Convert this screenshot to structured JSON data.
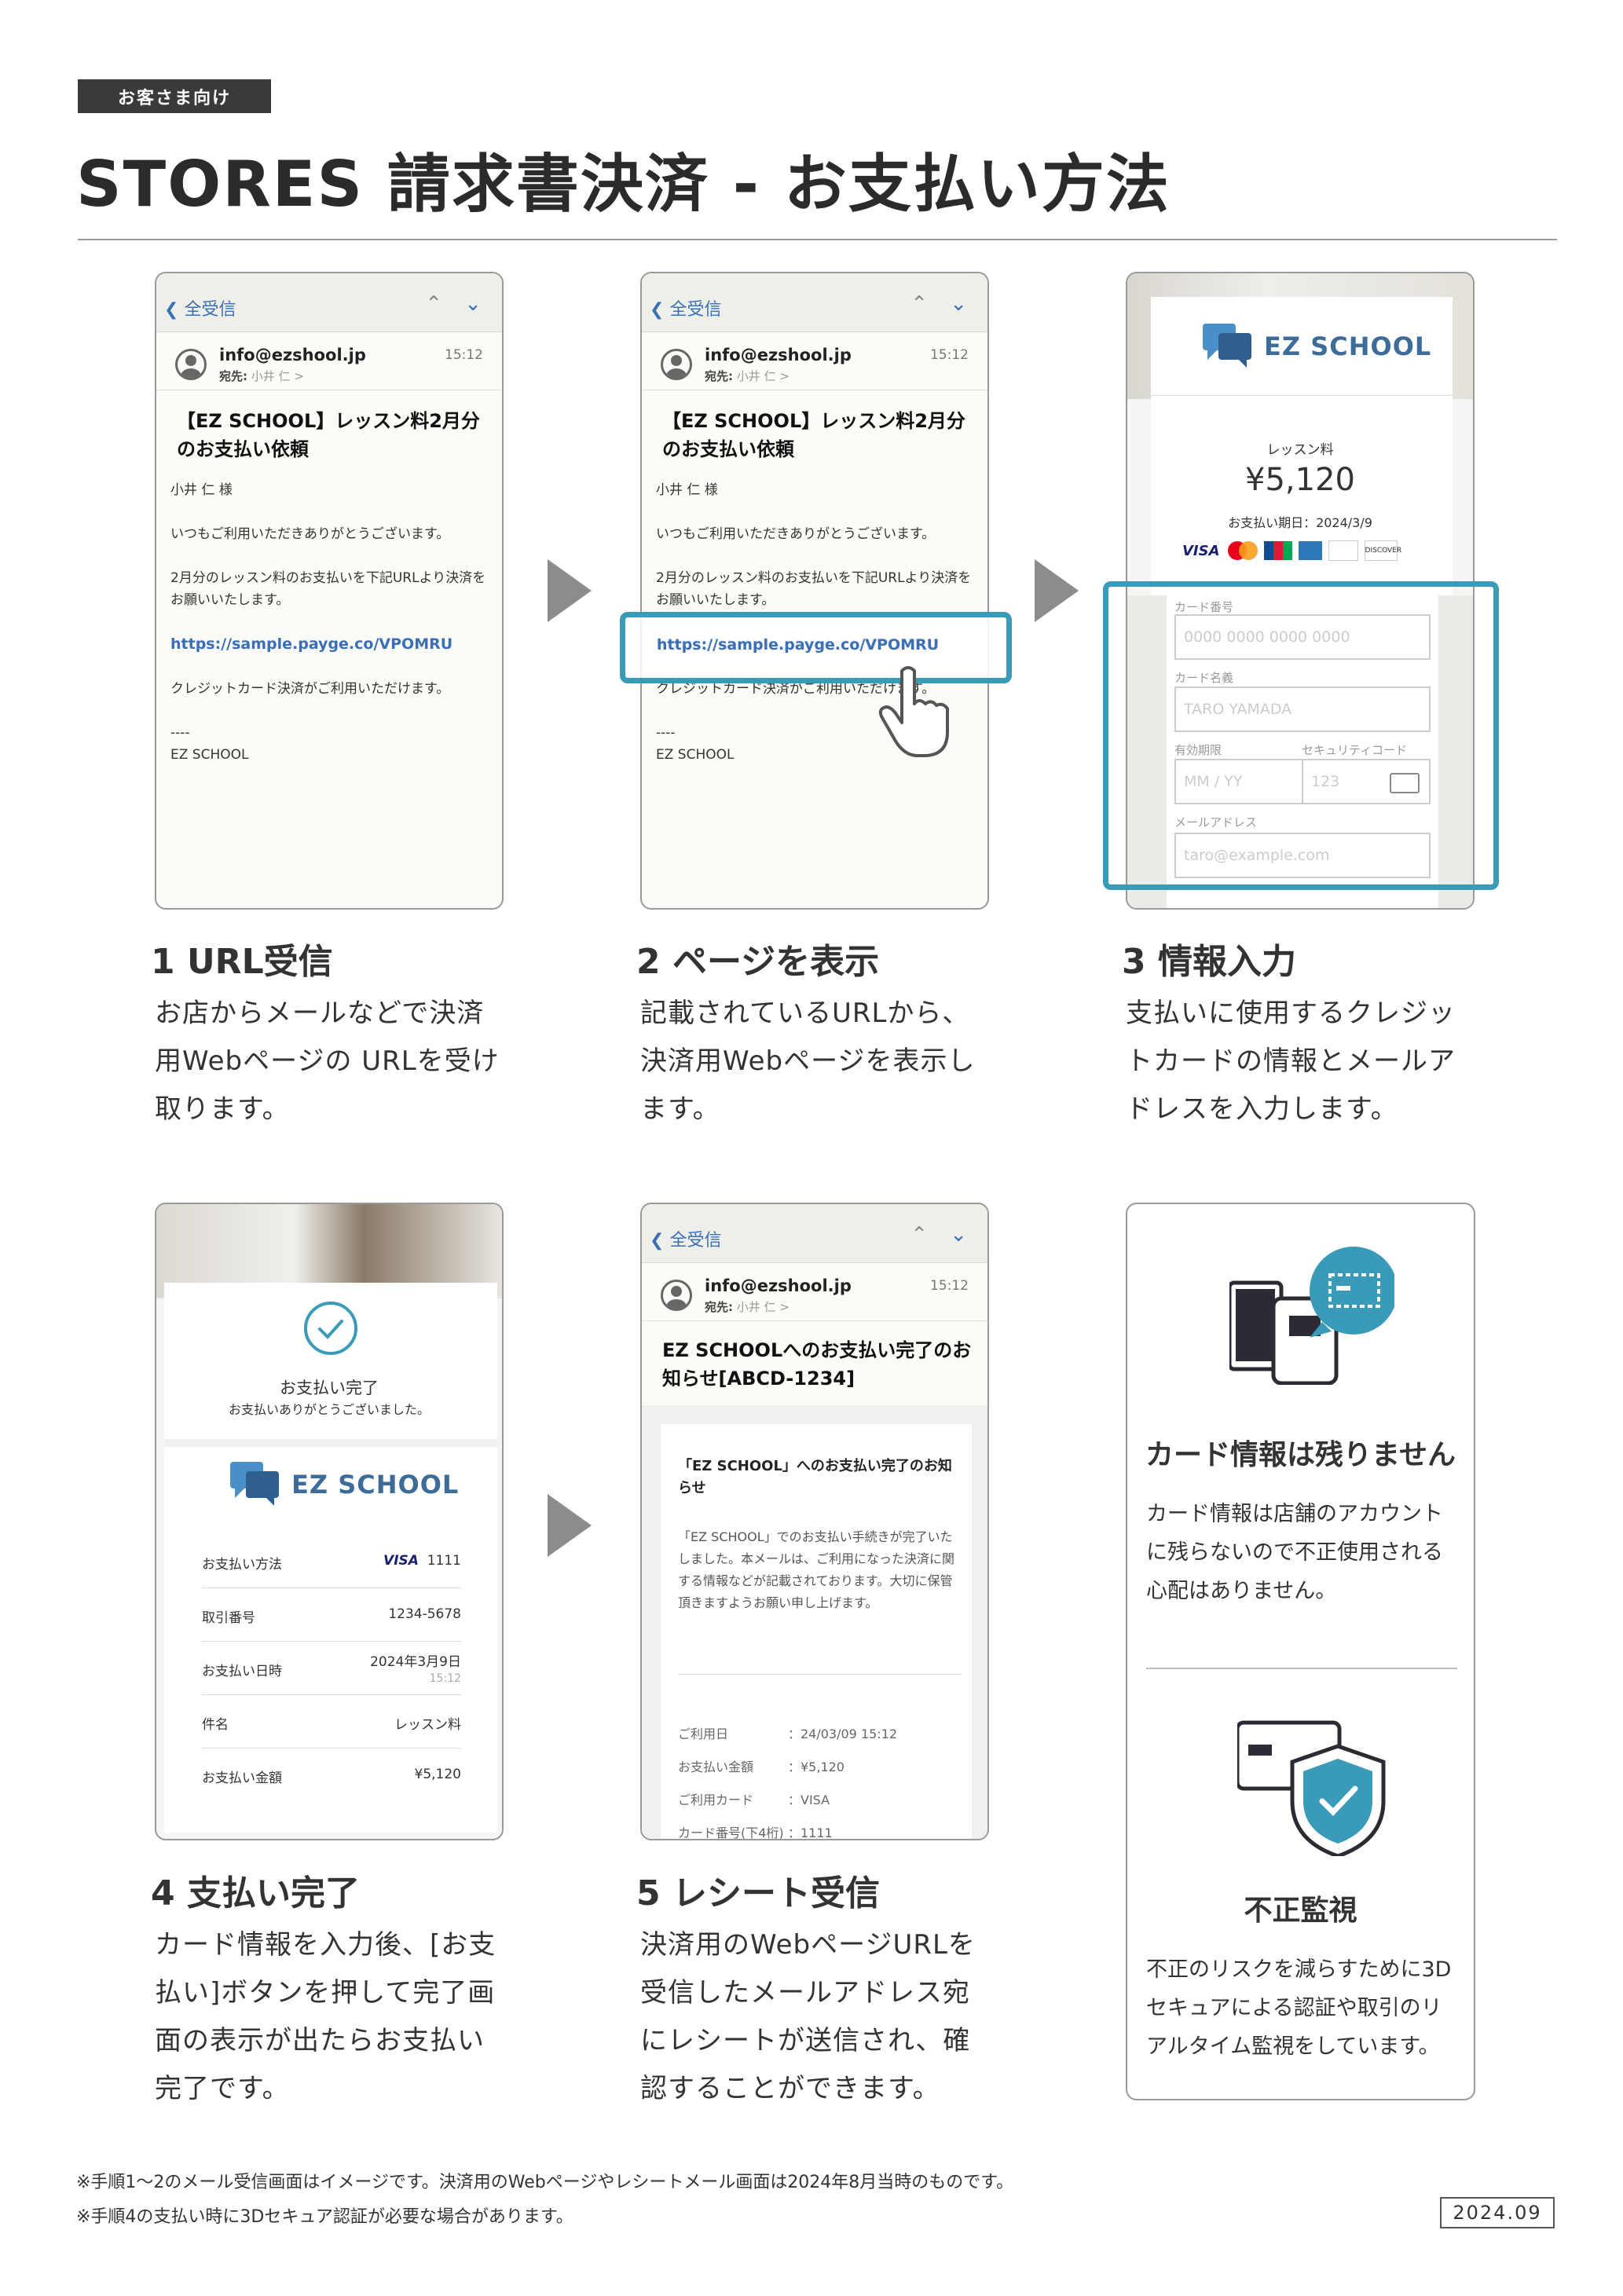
{
  "header": {
    "tag": "お客さま向け",
    "title": "STORES 請求書決済 - お支払い方法"
  },
  "email1": {
    "back_label": "全受信",
    "from": "info@ezshool.jp",
    "to_label": "宛先:",
    "to_name": "小井 仁 >",
    "time": "15:12",
    "subject": "【EZ SCHOOL】レッスン料2月分のお支払い依頼",
    "greeting": "小井 仁 様",
    "line1": "いつもご利用いただきありがとうございます。",
    "line2": "2月分のレッスン料のお支払いを下記URLより決済をお願いいたします。",
    "url": "https://sample.payge.co/VPOMRU",
    "line3": "クレジットカード決済がご利用いただけます。",
    "sig_sep": "----",
    "signature": "EZ SCHOOL"
  },
  "payment_form": {
    "brand": "EZ SCHOOL",
    "item": "レッスン料",
    "amount": "¥5,120",
    "due": "お支払い期日：2024/3/9",
    "card_brands": [
      "VISA",
      "Mastercard",
      "JCB",
      "AMEX",
      "Diners",
      "DISCOVER"
    ],
    "card_number_label": "カード番号",
    "card_number_placeholder": "0000 0000 0000 0000",
    "card_name_label": "カード名義",
    "card_name_placeholder": "TARO YAMADA",
    "expiry_label": "有効期限",
    "expiry_placeholder": "MM / YY",
    "cvc_label": "セキュリティコード",
    "cvc_placeholder": "123",
    "email_label": "メールアドレス",
    "email_placeholder": "taro@example.com"
  },
  "steps": [
    {
      "num": "1",
      "title": "URL受信",
      "desc": "お店からメールなどで決済用Webページの URLを受け取ります。"
    },
    {
      "num": "2",
      "title": "ページを表示",
      "desc": "記載されているURLから、決済用Webページを表示します。"
    },
    {
      "num": "3",
      "title": "情報入力",
      "desc": "支払いに使用するクレジットカードの情報とメールアドレスを入力します。"
    },
    {
      "num": "4",
      "title": "支払い完了",
      "desc": "カード情報を入力後、[お支払い]ボタンを押して完了画面の表示が出たらお支払い完了です。"
    },
    {
      "num": "5",
      "title": "レシート受信",
      "desc": "決済用のWebページURLを受信したメールアドレス宛にレシートが送信され、確認することができます。"
    }
  ],
  "complete": {
    "title": "お支払い完了",
    "subtitle": "お支払いありがとうございました。",
    "brand": "EZ SCHOOL",
    "method_label": "お支払い方法",
    "method_brand": "VISA",
    "method_last4": "1111",
    "txn_label": "取引番号",
    "txn_value": "1234-5678",
    "date_label": "お支払い日時",
    "date_value": "2024年3月9日",
    "time_value": "15:12",
    "item_label": "件名",
    "item_value": "レッスン料",
    "amount_label": "お支払い金額",
    "amount_value": "¥5,120"
  },
  "receipt": {
    "back_label": "全受信",
    "from": "info@ezshool.jp",
    "to_label": "宛先:",
    "to_name": "小井 仁 >",
    "time": "15:12",
    "subject": "EZ SCHOOLへのお支払い完了のお知らせ[ABCD-1234]",
    "inner_title": "「EZ SCHOOL」へのお支払い完了のお知らせ",
    "inner_body": "「EZ SCHOOL」でのお支払い手続きが完了いたしました。本メールは、ご利用になった決済に関する情報などが記載されております。大切に保管頂きますようお願い申し上げます。",
    "rows": [
      {
        "label": "ご利用日",
        "value": "：24/03/09 15:12"
      },
      {
        "label": "お支払い金額",
        "value": "：¥5,120"
      },
      {
        "label": "ご利用カード",
        "value": "：VISA"
      },
      {
        "label": "カード番号(下4桁)",
        "value": "：1111"
      }
    ]
  },
  "features": [
    {
      "title": "カード情報は残りません",
      "desc": "カード情報は店舗のアカウントに残らないので不正使用される心配はありません。"
    },
    {
      "title": "不正監視",
      "desc": "不正のリスクを減らすために3Dセキュアによる認証や取引のリアルタイム監視をしています。"
    }
  ],
  "footnotes": [
    "※手順1〜2のメール受信画面はイメージです。決済用のWebページやレシートメール画面は2024年8月当時のものです。",
    "※手順4の支払い時に3Dセキュア認証が必要な場合があります。"
  ],
  "date": "2024.09",
  "colors": {
    "accent": "#3a9bb8",
    "brand": "#3e6c98",
    "dark": "#3a3a3a"
  }
}
